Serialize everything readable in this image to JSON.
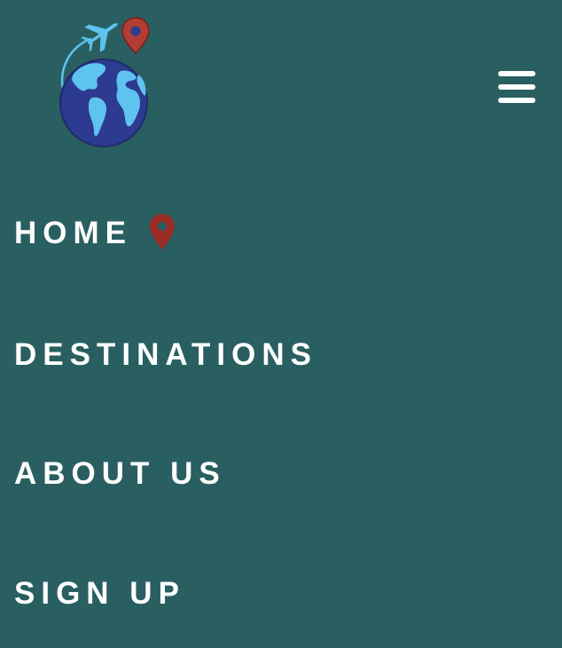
{
  "header": {
    "logo_icon": "globe-airplane-location-logo-icon",
    "menu_icon": "hamburger-menu-icon"
  },
  "nav": {
    "items": [
      {
        "label": "HOME",
        "active": true,
        "icon": "location-pin-icon"
      },
      {
        "label": "DESTINATIONS"
      },
      {
        "label": "ABOUT US"
      },
      {
        "label": "SIGN UP"
      }
    ]
  },
  "colors": {
    "background": "#295f60",
    "text": "#ffffff",
    "pin": "#9b2b26",
    "globe_ocean": "#2c3a8f",
    "globe_land": "#5ec3ef",
    "plane": "#5ec3ef"
  }
}
